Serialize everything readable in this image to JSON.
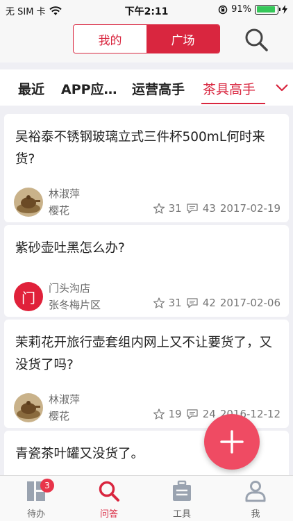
{
  "status_bar": {
    "carrier": "无 SIM 卡",
    "time": "下午2:11",
    "battery": "91%",
    "battery_level": 0.91
  },
  "header": {
    "segments": [
      "我的",
      "广场"
    ],
    "active_segment": "广场"
  },
  "category_tabs": {
    "items": [
      "最近",
      "APP应…",
      "运营高手",
      "茶具高手"
    ],
    "active": "茶具高手"
  },
  "posts": [
    {
      "title": "吴裕泰不锈钢玻璃立式三件杯500mL何时来货?",
      "author": "林淑萍",
      "location": "樱花",
      "stars": "31",
      "comments": "43",
      "date": "2017-02-19",
      "avatar_type": "photo"
    },
    {
      "title": "紫砂壶吐黑怎么办?",
      "author": "门头沟店",
      "location": "张冬梅片区",
      "stars": "31",
      "comments": "42",
      "date": "2017-02-06",
      "avatar_type": "letter",
      "avatar_letter": "门"
    },
    {
      "title": "茉莉花开旅行壶套组内网上又不让要货了，又没货了吗?",
      "author": "林淑萍",
      "location": "樱花",
      "stars": "19",
      "comments": "24",
      "date": "2016-12-12",
      "avatar_type": "photo"
    },
    {
      "title": "青瓷茶叶罐又没货了。"
    }
  ],
  "tab_bar": {
    "items": [
      {
        "label": "待办",
        "icon": "todo-icon",
        "badge": "3"
      },
      {
        "label": "问答",
        "icon": "search-icon"
      },
      {
        "label": "工具",
        "icon": "briefcase-icon"
      },
      {
        "label": "我",
        "icon": "person-icon"
      }
    ],
    "active": "问答"
  },
  "colors": {
    "accent": "#d9263f",
    "fab": "#ef4b63",
    "background": "#efeff4"
  }
}
